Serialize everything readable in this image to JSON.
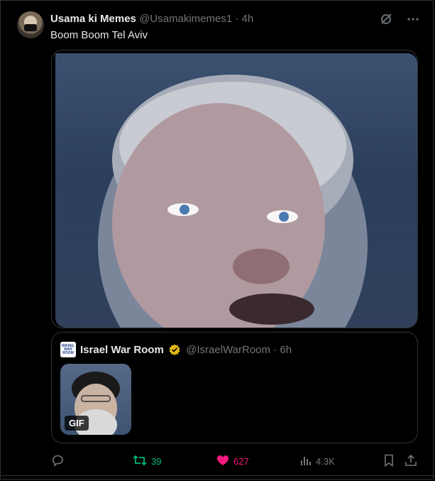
{
  "tweet": {
    "author_name": "Usama ki Memes",
    "author_handle": "@Usamakimemes1",
    "separator": "·",
    "time": "4h",
    "text": "Boom Boom Tel Aviv"
  },
  "quote": {
    "logo_text": "ISRAEL WAR ROOM",
    "author_name": "Israel War Room",
    "author_handle": "@IsraelWarRoom",
    "separator": "·",
    "time": "6h",
    "gif_badge": "GIF"
  },
  "actions": {
    "reply_count": "",
    "retweet_count": "39",
    "like_count": "627",
    "views_count": "4.3K"
  },
  "colors": {
    "retweet": "#00ba7c",
    "like": "#f91880",
    "muted": "#71767b",
    "verified_gold": "#e2b719"
  },
  "icons": [
    "grok-icon",
    "more-icon",
    "reply-icon",
    "retweet-icon",
    "heart-icon",
    "views-icon",
    "bookmark-icon",
    "share-icon"
  ]
}
